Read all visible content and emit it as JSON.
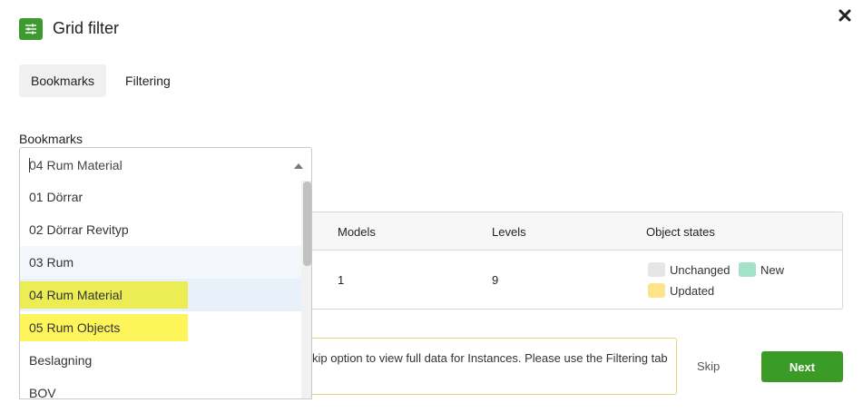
{
  "dialog": {
    "title": "Grid filter",
    "icon": "sliders-icon",
    "close_icon": "close-icon"
  },
  "tabs": [
    {
      "label": "Bookmarks",
      "active": true
    },
    {
      "label": "Filtering",
      "active": false
    }
  ],
  "bookmarks": {
    "label": "Bookmarks",
    "selected_value": "04 Rum Material",
    "options": [
      "01 Dörrar",
      "02 Dörrar Revityp",
      "03 Rum",
      "04 Rum Material",
      "05 Rum Objects",
      "Beslagning",
      "BOV"
    ]
  },
  "table": {
    "headers": [
      "Models",
      "Levels",
      "Object states"
    ],
    "row": {
      "models": "1",
      "levels": "9"
    },
    "object_states": [
      {
        "label": "Unchanged",
        "color": "#e6e6e6"
      },
      {
        "label": "New",
        "color": "#a3e1c9"
      },
      {
        "label": "Updated",
        "color": "#fde38a"
      }
    ]
  },
  "notice": {
    "text": "kip option to view full data for Instances. Please use the Filtering tab"
  },
  "footer": {
    "skip_label": "Skip",
    "next_label": "Next"
  },
  "colors": {
    "primary_green": "#3a9b27",
    "notice_border": "#e6d27a",
    "highlight_green": "#ecec55",
    "highlight_yellow": "#fdf55a"
  }
}
